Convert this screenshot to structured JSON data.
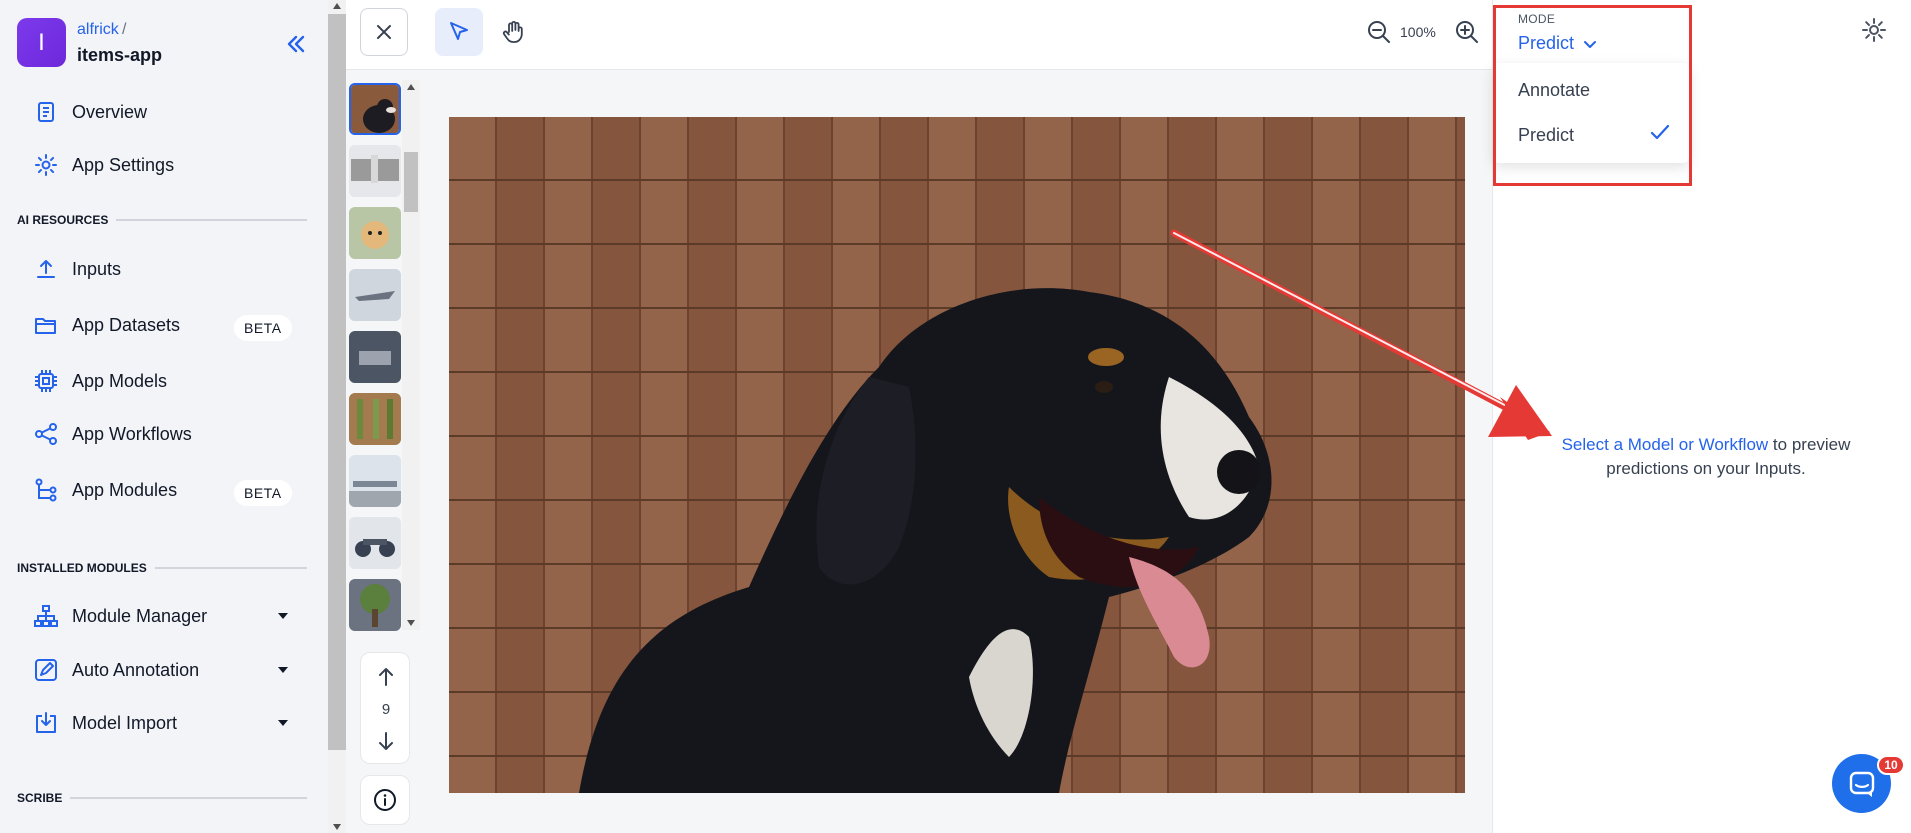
{
  "header": {
    "user": "alfrick",
    "separator": "/",
    "app_name": "items-app",
    "logo_letter": "I"
  },
  "sidebar": {
    "top_items": [
      {
        "label": "Overview",
        "icon": "document-icon"
      },
      {
        "label": "App Settings",
        "icon": "gear-icon"
      }
    ],
    "sections": {
      "ai_resources": "AI RESOURCES",
      "installed_modules": "INSTALLED MODULES",
      "scribe": "SCRIBE"
    },
    "ai_items": [
      {
        "label": "Inputs",
        "icon": "upload-icon"
      },
      {
        "label": "App Datasets",
        "icon": "folder-icon",
        "badge": "BETA"
      },
      {
        "label": "App Models",
        "icon": "chip-icon"
      },
      {
        "label": "App Workflows",
        "icon": "share-icon"
      },
      {
        "label": "App Modules",
        "icon": "branch-icon",
        "badge": "BETA"
      }
    ],
    "module_items": [
      {
        "label": "Module Manager",
        "icon": "hierarchy-icon"
      },
      {
        "label": "Auto Annotation",
        "icon": "edit-icon"
      },
      {
        "label": "Model Import",
        "icon": "import-icon"
      }
    ]
  },
  "toolbar": {
    "zoom_level": "100%"
  },
  "pager": {
    "current": "9"
  },
  "mode": {
    "label": "MODE",
    "selected": "Predict",
    "options": [
      "Annotate",
      "Predict"
    ]
  },
  "empty_state": {
    "link_text": "Select a Model or Workflow",
    "rest_text": " to preview predictions on your Inputs."
  },
  "chat": {
    "badge_count": "10"
  },
  "colors": {
    "accent": "#2563eb",
    "highlight": "#e53935",
    "sidebar_bg": "#f3f4f8"
  }
}
